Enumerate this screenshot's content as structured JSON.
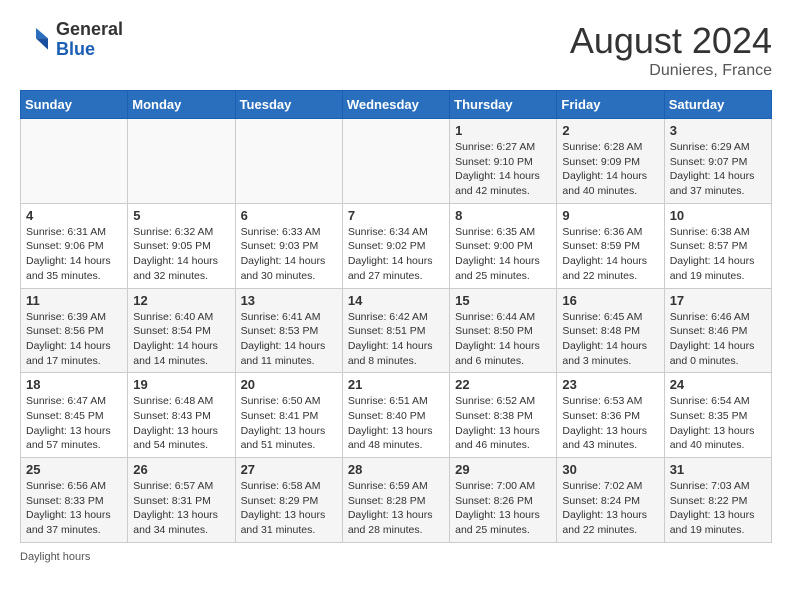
{
  "header": {
    "logo_general": "General",
    "logo_blue": "Blue",
    "month_title": "August 2024",
    "location": "Dunieres, France"
  },
  "days_of_week": [
    "Sunday",
    "Monday",
    "Tuesday",
    "Wednesday",
    "Thursday",
    "Friday",
    "Saturday"
  ],
  "weeks": [
    [
      {
        "day": "",
        "info": ""
      },
      {
        "day": "",
        "info": ""
      },
      {
        "day": "",
        "info": ""
      },
      {
        "day": "",
        "info": ""
      },
      {
        "day": "1",
        "info": "Sunrise: 6:27 AM\nSunset: 9:10 PM\nDaylight: 14 hours and 42 minutes."
      },
      {
        "day": "2",
        "info": "Sunrise: 6:28 AM\nSunset: 9:09 PM\nDaylight: 14 hours and 40 minutes."
      },
      {
        "day": "3",
        "info": "Sunrise: 6:29 AM\nSunset: 9:07 PM\nDaylight: 14 hours and 37 minutes."
      }
    ],
    [
      {
        "day": "4",
        "info": "Sunrise: 6:31 AM\nSunset: 9:06 PM\nDaylight: 14 hours and 35 minutes."
      },
      {
        "day": "5",
        "info": "Sunrise: 6:32 AM\nSunset: 9:05 PM\nDaylight: 14 hours and 32 minutes."
      },
      {
        "day": "6",
        "info": "Sunrise: 6:33 AM\nSunset: 9:03 PM\nDaylight: 14 hours and 30 minutes."
      },
      {
        "day": "7",
        "info": "Sunrise: 6:34 AM\nSunset: 9:02 PM\nDaylight: 14 hours and 27 minutes."
      },
      {
        "day": "8",
        "info": "Sunrise: 6:35 AM\nSunset: 9:00 PM\nDaylight: 14 hours and 25 minutes."
      },
      {
        "day": "9",
        "info": "Sunrise: 6:36 AM\nSunset: 8:59 PM\nDaylight: 14 hours and 22 minutes."
      },
      {
        "day": "10",
        "info": "Sunrise: 6:38 AM\nSunset: 8:57 PM\nDaylight: 14 hours and 19 minutes."
      }
    ],
    [
      {
        "day": "11",
        "info": "Sunrise: 6:39 AM\nSunset: 8:56 PM\nDaylight: 14 hours and 17 minutes."
      },
      {
        "day": "12",
        "info": "Sunrise: 6:40 AM\nSunset: 8:54 PM\nDaylight: 14 hours and 14 minutes."
      },
      {
        "day": "13",
        "info": "Sunrise: 6:41 AM\nSunset: 8:53 PM\nDaylight: 14 hours and 11 minutes."
      },
      {
        "day": "14",
        "info": "Sunrise: 6:42 AM\nSunset: 8:51 PM\nDaylight: 14 hours and 8 minutes."
      },
      {
        "day": "15",
        "info": "Sunrise: 6:44 AM\nSunset: 8:50 PM\nDaylight: 14 hours and 6 minutes."
      },
      {
        "day": "16",
        "info": "Sunrise: 6:45 AM\nSunset: 8:48 PM\nDaylight: 14 hours and 3 minutes."
      },
      {
        "day": "17",
        "info": "Sunrise: 6:46 AM\nSunset: 8:46 PM\nDaylight: 14 hours and 0 minutes."
      }
    ],
    [
      {
        "day": "18",
        "info": "Sunrise: 6:47 AM\nSunset: 8:45 PM\nDaylight: 13 hours and 57 minutes."
      },
      {
        "day": "19",
        "info": "Sunrise: 6:48 AM\nSunset: 8:43 PM\nDaylight: 13 hours and 54 minutes."
      },
      {
        "day": "20",
        "info": "Sunrise: 6:50 AM\nSunset: 8:41 PM\nDaylight: 13 hours and 51 minutes."
      },
      {
        "day": "21",
        "info": "Sunrise: 6:51 AM\nSunset: 8:40 PM\nDaylight: 13 hours and 48 minutes."
      },
      {
        "day": "22",
        "info": "Sunrise: 6:52 AM\nSunset: 8:38 PM\nDaylight: 13 hours and 46 minutes."
      },
      {
        "day": "23",
        "info": "Sunrise: 6:53 AM\nSunset: 8:36 PM\nDaylight: 13 hours and 43 minutes."
      },
      {
        "day": "24",
        "info": "Sunrise: 6:54 AM\nSunset: 8:35 PM\nDaylight: 13 hours and 40 minutes."
      }
    ],
    [
      {
        "day": "25",
        "info": "Sunrise: 6:56 AM\nSunset: 8:33 PM\nDaylight: 13 hours and 37 minutes."
      },
      {
        "day": "26",
        "info": "Sunrise: 6:57 AM\nSunset: 8:31 PM\nDaylight: 13 hours and 34 minutes."
      },
      {
        "day": "27",
        "info": "Sunrise: 6:58 AM\nSunset: 8:29 PM\nDaylight: 13 hours and 31 minutes."
      },
      {
        "day": "28",
        "info": "Sunrise: 6:59 AM\nSunset: 8:28 PM\nDaylight: 13 hours and 28 minutes."
      },
      {
        "day": "29",
        "info": "Sunrise: 7:00 AM\nSunset: 8:26 PM\nDaylight: 13 hours and 25 minutes."
      },
      {
        "day": "30",
        "info": "Sunrise: 7:02 AM\nSunset: 8:24 PM\nDaylight: 13 hours and 22 minutes."
      },
      {
        "day": "31",
        "info": "Sunrise: 7:03 AM\nSunset: 8:22 PM\nDaylight: 13 hours and 19 minutes."
      }
    ]
  ],
  "footer": {
    "text": "Daylight hours"
  }
}
